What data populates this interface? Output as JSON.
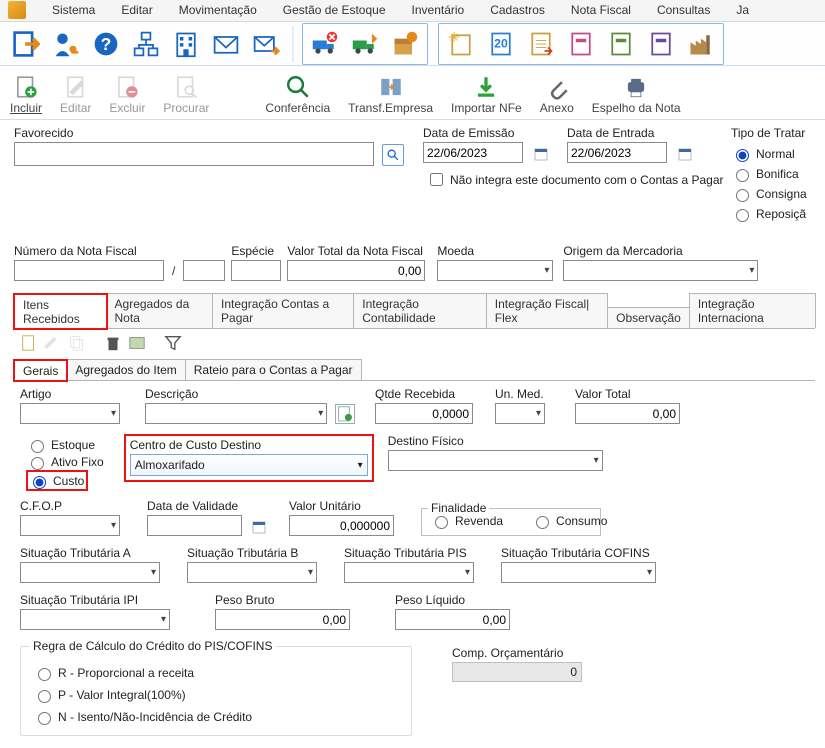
{
  "menu": [
    "Sistema",
    "Editar",
    "Movimentação",
    "Gestão de Estoque",
    "Inventário",
    "Cadastros",
    "Nota Fiscal",
    "Consultas",
    "Ja"
  ],
  "toolbar2": {
    "incluir": "Incluir",
    "editar": "Editar",
    "excluir": "Excluir",
    "procurar": "Procurar",
    "conferencia": "Conferência",
    "transf": "Transf.Empresa",
    "importar": "Importar NFe",
    "anexo": "Anexo",
    "espelho": "Espelho da Nota"
  },
  "header": {
    "favorecido_label": "Favorecido",
    "data_emissao_label": "Data de Emissão",
    "data_emissao_value": "22/06/2023",
    "data_entrada_label": "Data de Entrada",
    "data_entrada_value": "22/06/2023",
    "nao_integra_label": "Não integra este documento com o Contas a Pagar",
    "numero_nf_label": "Número da Nota Fiscal",
    "especie_label": "Espécie",
    "valor_total_label": "Valor Total da Nota Fiscal",
    "valor_total_value": "0,00",
    "moeda_label": "Moeda",
    "origem_label": "Origem da Mercadoria",
    "tipo_tratar_label": "Tipo de Tratar",
    "tipo_options": {
      "normal": "Normal",
      "bonific": "Bonifica",
      "consigna": "Consigna",
      "repos": "Reposiçã"
    }
  },
  "tabs": [
    "Itens Recebidos",
    "Agregados da Nota",
    "Integração Contas a Pagar",
    "Integração Contabilidade",
    "Integração Fiscal| Flex",
    "Observação",
    "Integração Internaciona"
  ],
  "subtabs": [
    "Gerais",
    "Agregados do Item",
    "Rateio para o Contas a Pagar"
  ],
  "item": {
    "artigo_label": "Artigo",
    "descricao_label": "Descrição",
    "qtde_label": "Qtde Recebida",
    "qtde_value": "0,0000",
    "unmed_label": "Un. Med.",
    "valor_total_label": "Valor Total",
    "valor_total_value": "0,00",
    "radio": {
      "estoque": "Estoque",
      "ativo": "Ativo Fixo",
      "custo": "Custo"
    },
    "cc_label": "Centro de Custo Destino",
    "cc_value": "Almoxarifado",
    "destino_label": "Destino Físico",
    "cfop_label": "C.F.O.P",
    "data_validade_label": "Data de Validade",
    "valor_unit_label": "Valor Unitário",
    "valor_unit_value": "0,000000",
    "finalidade_label": "Finalidade",
    "finalidade_revenda": "Revenda",
    "finalidade_consumo": "Consumo",
    "sit_a": "Situação Tributária A",
    "sit_b": "Situação Tributária B",
    "sit_pis": "Situação Tributária PIS",
    "sit_cofins": "Situação Tributária COFINS",
    "sit_ipi": "Situação Tributária IPI",
    "peso_bruto_label": "Peso Bruto",
    "peso_bruto_value": "0,00",
    "peso_liq_label": "Peso Líquido",
    "peso_liq_value": "0,00",
    "regra_legend": "Regra de Cálculo do Crédito do PIS/COFINS",
    "regra_r": "R - Proporcional a receita",
    "regra_p": "P - Valor Integral(100%)",
    "regra_n": "N - Isento/Não-Incidência de Crédito",
    "comp_orc_label": "Comp. Orçamentário",
    "comp_orc_value": "0"
  }
}
